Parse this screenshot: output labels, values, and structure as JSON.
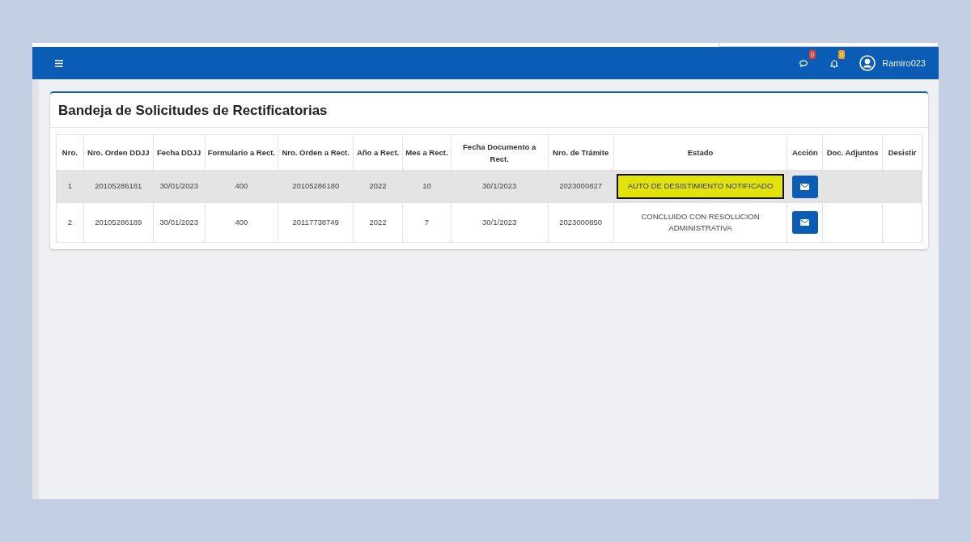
{
  "navbar": {
    "user": "Ramiro023",
    "messages_count": "0",
    "notifications_count": "0"
  },
  "card": {
    "title": "Bandeja de Solicitudes de Rectificatorias"
  },
  "table": {
    "columns": [
      "Nro.",
      "Nro. Orden DDJJ",
      "Fecha DDJJ",
      "Formulario a Rect.",
      "Nro. Orden a Rect.",
      "Año a Rect.",
      "Mes a Rect.",
      "Fecha Documento a Rect.",
      "Nro. de Trámite",
      "Estado",
      "Acción",
      "Doc. Adjuntos",
      "Desistir"
    ],
    "rows": [
      {
        "selected": true,
        "cells": [
          "1",
          "20105286181",
          "30/01/2023",
          "400",
          "20105286180",
          "2022",
          "10",
          "30/1/2023",
          "2023000827"
        ],
        "estado": "AUTO DE DESISTIMIENTO NOTIFICADO",
        "estado_highlighted": true
      },
      {
        "selected": false,
        "cells": [
          "2",
          "20105286189",
          "30/01/2023",
          "400",
          "20117738749",
          "2022",
          "7",
          "30/1/2023",
          "2023000850"
        ],
        "estado": "CONCLUIDO CON RESOLUCION ADMINISTRATIVA",
        "estado_highlighted": false
      }
    ]
  }
}
